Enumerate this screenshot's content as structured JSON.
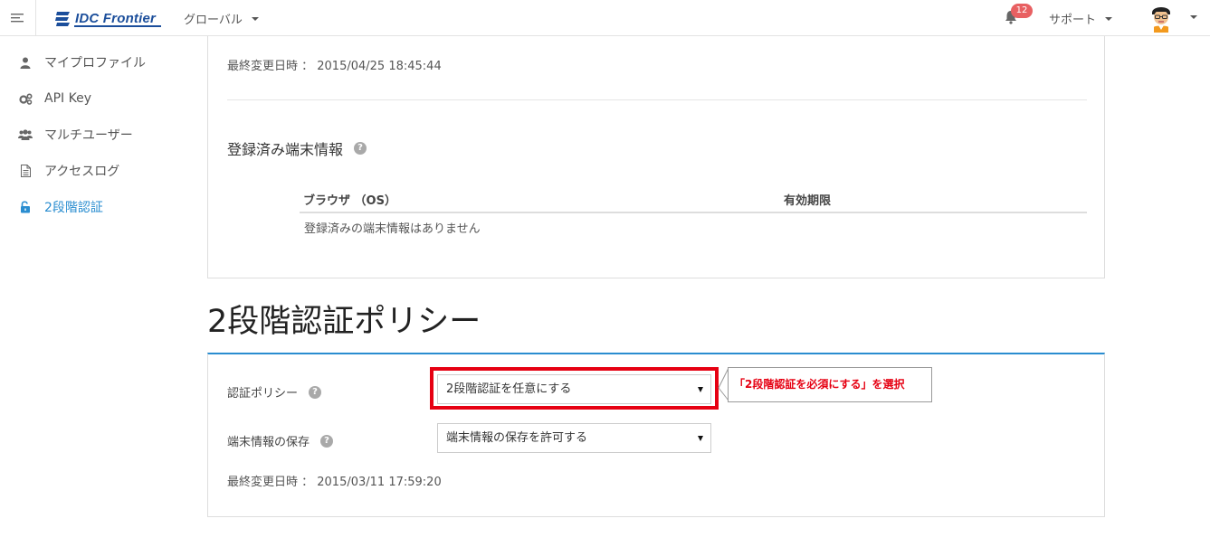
{
  "topbar": {
    "logo_text": "IDC Frontier",
    "region_label": "グローバル",
    "notification_count": "12",
    "support_label": "サポート"
  },
  "sidebar": {
    "items": [
      {
        "label": "マイプロファイル",
        "icon": "user-icon",
        "active": false
      },
      {
        "label": "API Key",
        "icon": "gears-icon",
        "active": false
      },
      {
        "label": "マルチユーザー",
        "icon": "users-icon",
        "active": false
      },
      {
        "label": "アクセスログ",
        "icon": "file-icon",
        "active": false
      },
      {
        "label": "2段階認証",
        "icon": "unlock-icon",
        "active": true
      }
    ]
  },
  "device_card": {
    "last_modified": "最終変更日時 ： 2015/04/25 18:45:44",
    "heading": "登録済み端末情報",
    "table": {
      "columns": [
        "ブラウザ （OS）",
        "有効期限"
      ],
      "empty_message": "登録済みの端末情報はありません"
    }
  },
  "policy": {
    "section_title": "2段階認証ポリシー",
    "auth_policy_label": "認証ポリシー",
    "auth_policy_value": "2段階認証を任意にする",
    "device_save_label": "端末情報の保存",
    "device_save_value": "端末情報の保存を許可する",
    "last_modified": "最終変更日時 ： 2015/03/11 17:59:20",
    "callout_text": "「2段階認証を必須にする」を選択"
  },
  "colors": {
    "accent": "#2a8dd0",
    "highlight": "#e60012",
    "badge": "#e86062",
    "logo": "#1b4e9b"
  }
}
